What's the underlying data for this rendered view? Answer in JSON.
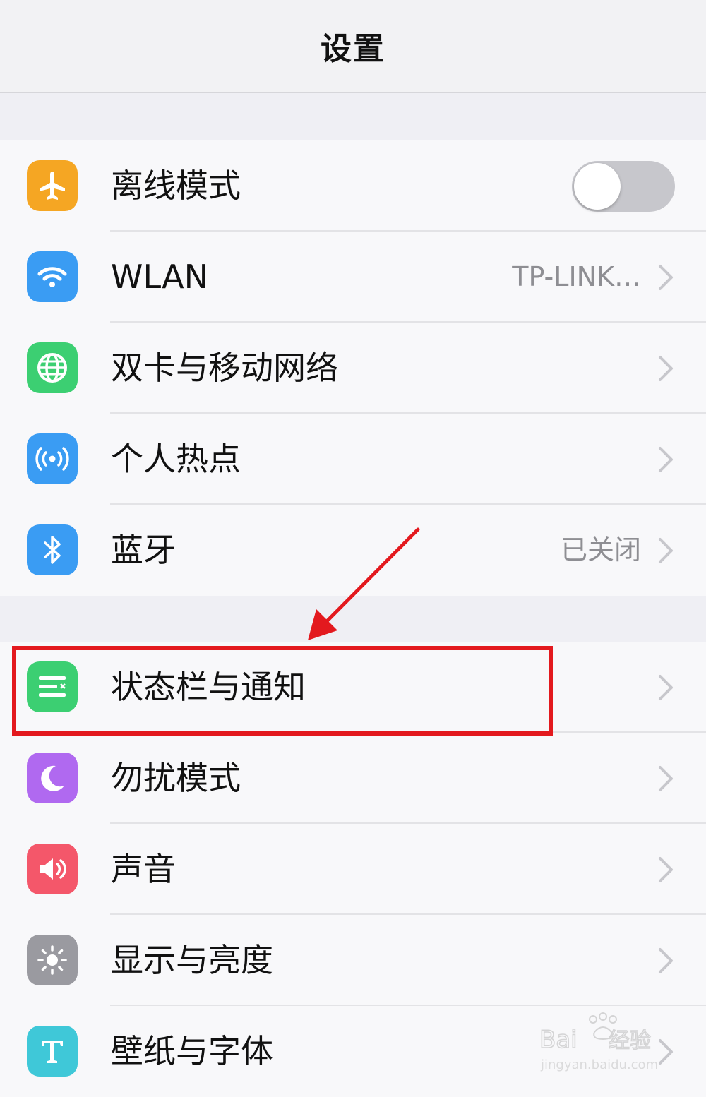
{
  "navbar": {
    "title": "设置"
  },
  "group1": [
    {
      "label": "离线模式",
      "icon": "airplane-icon",
      "color": "#f5a623",
      "toggle": false
    },
    {
      "label": "WLAN",
      "icon": "wifi-icon",
      "color": "#3a9cf3",
      "value": "TP-LINK…"
    },
    {
      "label": "双卡与移动网络",
      "icon": "globe-icon",
      "color": "#3ccf72"
    },
    {
      "label": "个人热点",
      "icon": "hotspot-icon",
      "color": "#3a9cf3"
    },
    {
      "label": "蓝牙",
      "icon": "bluetooth-icon",
      "color": "#3a9cf3",
      "value": "已关闭"
    }
  ],
  "group2": [
    {
      "label": "状态栏与通知",
      "icon": "status-bar-icon",
      "color": "#3ccf72"
    },
    {
      "label": "勿扰模式",
      "icon": "moon-icon",
      "color": "#b069f0"
    },
    {
      "label": "声音",
      "icon": "speaker-icon",
      "color": "#f4576a"
    },
    {
      "label": "显示与亮度",
      "icon": "sun-icon",
      "color": "#9a9aa0"
    },
    {
      "label": "壁纸与字体",
      "icon": "font-t-icon",
      "color": "#3fc8d8"
    }
  ],
  "annotation": {
    "color": "#e3191e"
  },
  "watermark": {
    "brand": "Bai du 经验",
    "url": "jingyan.baidu.com"
  }
}
